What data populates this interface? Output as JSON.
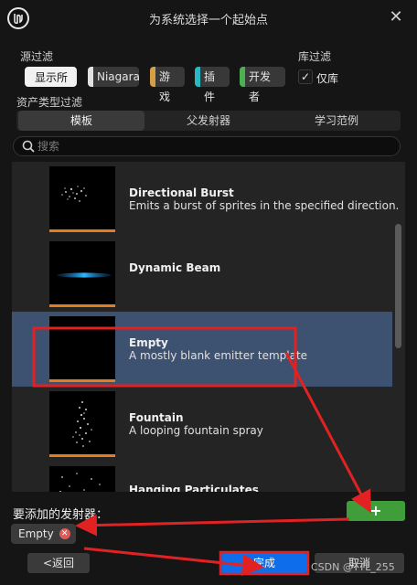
{
  "window": {
    "title": "为系统选择一个起始点"
  },
  "filters": {
    "source_label": "源过滤",
    "library_label": "库过滤",
    "chips": [
      {
        "label": "显示所有",
        "selected": true,
        "color": "#f2f2f2"
      },
      {
        "label": "Niagara",
        "selected": false,
        "color": "#e2e2e2"
      },
      {
        "label": "游戏",
        "selected": false,
        "color": "#d4a043"
      },
      {
        "label": "插件",
        "selected": false,
        "color": "#29b7c4"
      },
      {
        "label": "开发者",
        "selected": false,
        "color": "#4caf50"
      }
    ],
    "library_only": {
      "label": "仅库",
      "checked": true
    }
  },
  "asset_type": {
    "label": "资产类型过滤",
    "tabs": [
      "模板",
      "父发射器",
      "学习范例"
    ],
    "active_tab": 0
  },
  "search": {
    "placeholder": "搜索",
    "value": ""
  },
  "emitters": [
    {
      "name": "Directional Burst",
      "description": "Emits a burst of sprites in the specified direction.",
      "selected": false
    },
    {
      "name": "Dynamic Beam",
      "description": "",
      "selected": false
    },
    {
      "name": "Empty",
      "description": "A mostly blank emitter template",
      "selected": true
    },
    {
      "name": "Fountain",
      "description": "A looping fountain spray",
      "selected": false
    },
    {
      "name": "Hanging Particulates",
      "description": "",
      "selected": false
    }
  ],
  "footer": {
    "emitters_to_add_label": "要添加的发射器：",
    "add_button": "+",
    "selected_emitter": "Empty",
    "back_button": "<返回",
    "done_button": "完成",
    "cancel_button": "取消",
    "watermark": "CSDN @TTL_255"
  },
  "colors": {
    "accent_blue": "#0e6dea",
    "add_green": "#3f9d3a",
    "selection": "#3d5170",
    "annotation_red": "#e22222",
    "thumb_underline": "#e67d1c"
  }
}
